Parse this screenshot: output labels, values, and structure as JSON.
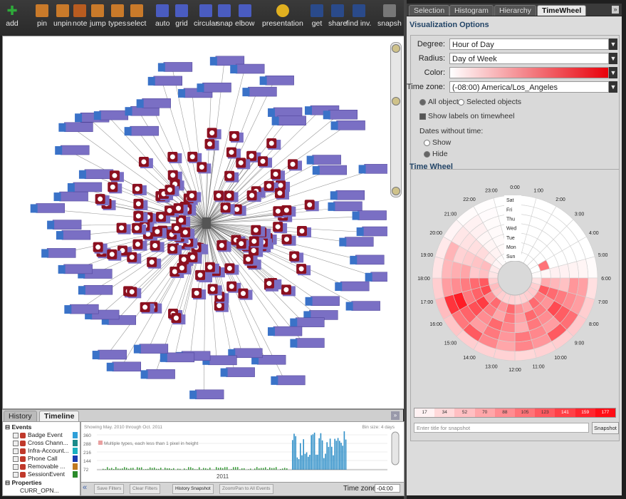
{
  "toolbar": {
    "items": [
      {
        "label": "add",
        "icon": "plus-icon",
        "color": "#2eaa3a"
      },
      {
        "label": "pin",
        "icon": "pin-icon",
        "color": "#c97a2a"
      },
      {
        "label": "unpin",
        "icon": "unpin-icon",
        "color": "#c97a2a"
      },
      {
        "label": "note",
        "icon": "note-icon",
        "color": "#b85c20"
      },
      {
        "label": "jump",
        "icon": "jump-icon",
        "color": "#c97a2a"
      },
      {
        "label": "types",
        "icon": "types-icon",
        "color": "#c97a2a"
      },
      {
        "label": "select",
        "icon": "select-icon",
        "color": "#c97a2a"
      },
      {
        "label": "auto",
        "icon": "auto-layout-icon",
        "color": "#4a5cc0"
      },
      {
        "label": "grid",
        "icon": "grid-layout-icon",
        "color": "#4a5cc0"
      },
      {
        "label": "circular",
        "icon": "circular-layout-icon",
        "color": "#4a5cc0"
      },
      {
        "label": "snap",
        "icon": "snap-icon",
        "color": "#4a5cc0"
      },
      {
        "label": "elbow",
        "icon": "elbow-icon",
        "color": "#4a5cc0"
      },
      {
        "label": "presentation",
        "icon": "presentation-icon",
        "color": "#e0b020"
      },
      {
        "label": "get",
        "icon": "get-icon",
        "color": "#2a4a8a"
      },
      {
        "label": "share",
        "icon": "share-icon",
        "color": "#2a4a8a"
      },
      {
        "label": "find inv.",
        "icon": "find-investigation-icon",
        "color": "#2a4a8a"
      },
      {
        "label": "snapsh",
        "icon": "snapshot-icon",
        "color": "#777777"
      }
    ]
  },
  "right_tabs": [
    {
      "label": "Selection",
      "icon": "selection-icon"
    },
    {
      "label": "Histogram",
      "icon": "histogram-icon"
    },
    {
      "label": "Hierarchy",
      "icon": "hierarchy-icon"
    },
    {
      "label": "TimeWheel",
      "icon": "timewheel-icon"
    }
  ],
  "viz": {
    "title": "Visualization Options",
    "degree_label": "Degree:",
    "degree_value": "Hour of Day",
    "radius_label": "Radius:",
    "radius_value": "Day of Week",
    "color_label": "Color:",
    "timezone_label": "Time zone:",
    "timezone_value": "(-08:00) America/Los_Angeles",
    "all_objects": "All objects",
    "selected_objects": "Selected objects",
    "show_labels": "Show labels on timewheel",
    "dates_without_time": "Dates without time:",
    "show": "Show",
    "hide": "Hide",
    "accent": "#e8000a"
  },
  "timewheel": {
    "title": "Time Wheel",
    "hours": [
      "0:00",
      "1:00",
      "2:00",
      "3:00",
      "4:00",
      "5:00",
      "6:00",
      "7:00",
      "8:00",
      "9:00",
      "10:00",
      "11:00",
      "12:00",
      "13:00",
      "14:00",
      "15:00",
      "16:00",
      "17:00",
      "18:00",
      "19:00",
      "20:00",
      "21:00",
      "22:00",
      "23:00"
    ],
    "days": [
      "Sat",
      "Fri",
      "Thu",
      "Wed",
      "Tue",
      "Mon",
      "Sun"
    ],
    "legend": [
      "17",
      "34",
      "52",
      "70",
      "88",
      "105",
      "123",
      "141",
      "159",
      "177"
    ],
    "snapshot_placeholder": "Enter title for snapshot",
    "snapshot_button": "Snapshot"
  },
  "bottom_tabs": [
    {
      "label": "History"
    },
    {
      "label": "Timeline"
    }
  ],
  "events": {
    "root": "Events",
    "items": [
      {
        "label": "Badge Event",
        "color": "#2f9fd8"
      },
      {
        "label": "Cross Chann...",
        "color": "#1a8a8a"
      },
      {
        "label": "Infra-Account...",
        "color": "#1ab0c0"
      },
      {
        "label": "Phone Call",
        "color": "#1a3ab0"
      },
      {
        "label": "Removable ...",
        "color": "#c07a20"
      },
      {
        "label": "SessionEvent",
        "color": "#2a8a2a"
      }
    ],
    "properties": "Properties",
    "prop_item": "CURR_OPN..."
  },
  "timeline": {
    "showing": "Showing May. 2010 through Oct. 2011",
    "bin_size": "Bin size: 4 days",
    "y_ticks": [
      "360",
      "288",
      "216",
      "144",
      "72"
    ],
    "note": "Multiple types, each less than 1 pixel in height",
    "year": "2011",
    "buttons": [
      "Save Filters",
      "Clear Filters",
      "History Snapshot",
      "Zoom/Pan to All Events"
    ],
    "timezone_label": "Time zone:",
    "timezone_value": "-04:00"
  }
}
